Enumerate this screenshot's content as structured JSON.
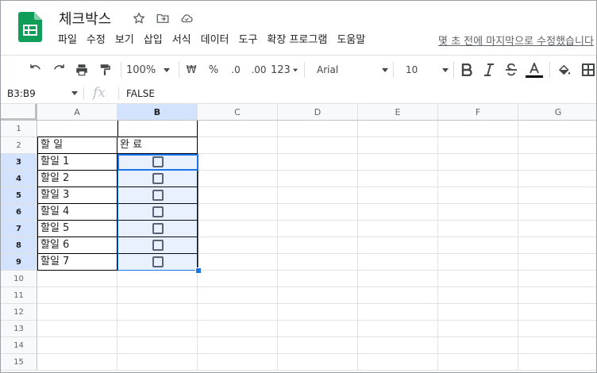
{
  "doc": {
    "title": "체크박스",
    "last_edit": "몇 초 전에 마지막으로 수정했습니다"
  },
  "menu": [
    "파일",
    "수정",
    "보기",
    "삽입",
    "서식",
    "데이터",
    "도구",
    "확장 프로그램",
    "도움말"
  ],
  "toolbar": {
    "zoom": "100%",
    "currency": "₩",
    "percent": "%",
    "dec_less": ".0",
    "dec_more": ".00",
    "number_format": "123",
    "font": "Arial",
    "font_size": "10"
  },
  "formula_bar": {
    "name_box": "B3:B9",
    "fx": "fx",
    "value": "FALSE"
  },
  "columns": [
    "A",
    "B",
    "C",
    "D",
    "E",
    "F",
    "G"
  ],
  "rows": [
    "1",
    "2",
    "3",
    "4",
    "5",
    "6",
    "7",
    "8",
    "9",
    "10",
    "11",
    "12",
    "13",
    "14",
    "15"
  ],
  "cells": {
    "a2": "할 일",
    "b2": "완 료",
    "tasks": [
      "할일 1",
      "할일 2",
      "할일 3",
      "할일 4",
      "할일 5",
      "할일 6",
      "할일 7"
    ]
  },
  "colors": {
    "selection": "#1a73e8",
    "sheets_green": "#0f9d58",
    "header_selected": "#d3e3fd"
  }
}
